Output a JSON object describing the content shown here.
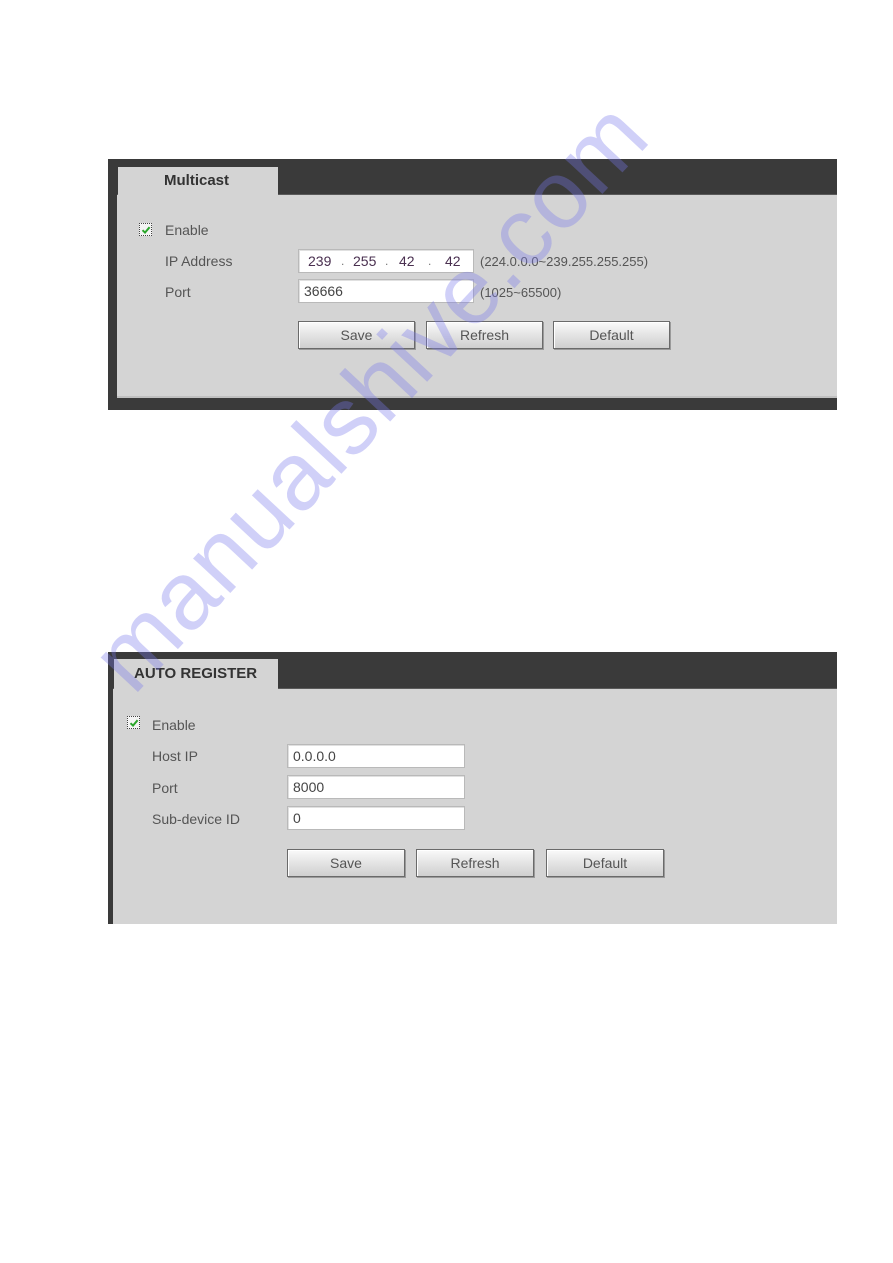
{
  "multicast": {
    "tab_label": "Multicast",
    "enable": {
      "label": "Enable",
      "checked": true
    },
    "ip_address": {
      "label": "IP Address",
      "segments": [
        "239",
        "255",
        "42",
        "42"
      ],
      "separator": ".",
      "hint": "(224.0.0.0~239.255.255.255)"
    },
    "port": {
      "label": "Port",
      "value": "36666",
      "hint": "(1025~65500)"
    },
    "buttons": {
      "save": "Save",
      "refresh": "Refresh",
      "default": "Default"
    }
  },
  "auto_register": {
    "tab_label": "AUTO REGISTER",
    "enable": {
      "label": "Enable",
      "checked": true
    },
    "host_ip": {
      "label": "Host IP",
      "value": "0.0.0.0"
    },
    "port": {
      "label": "Port",
      "value": "8000"
    },
    "sub_device_id": {
      "label": "Sub-device ID",
      "value": "0"
    },
    "buttons": {
      "save": "Save",
      "refresh": "Refresh",
      "default": "Default"
    }
  },
  "watermark": {
    "text": "manualshive.com"
  },
  "colors": {
    "panel_frame": "#3a3a3a",
    "panel_body": "#d4d4d4",
    "checkmark": "#2aa52a",
    "watermark": "#7878eb"
  }
}
